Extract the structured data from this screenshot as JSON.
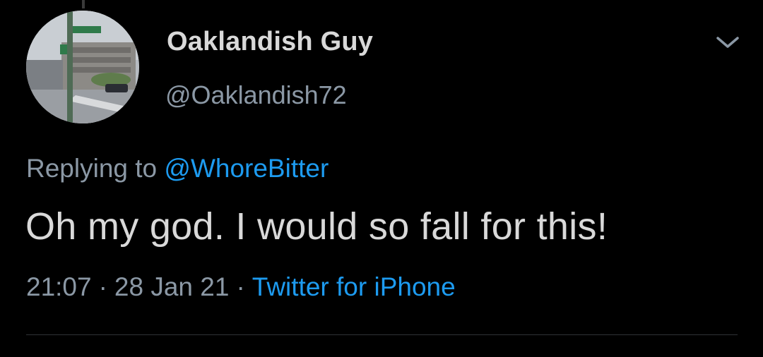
{
  "tweet": {
    "display_name": "Oaklandish Guy",
    "handle": "@Oaklandish72",
    "replying_prefix": "Replying to",
    "replying_to": "@WhoreBitter",
    "text": "Oh my god. I would so fall for this!",
    "time": "21:07",
    "date": "28 Jan 21",
    "separator": "·",
    "source": "Twitter for iPhone"
  },
  "icons": {
    "avatar": "avatar-photo-street-scene",
    "menu": "chevron-down-icon"
  },
  "colors": {
    "background": "#000000",
    "primary_text": "#d9d9d9",
    "secondary_text": "#8b98a5",
    "accent": "#1d9bf0",
    "divider": "#2f3336"
  }
}
